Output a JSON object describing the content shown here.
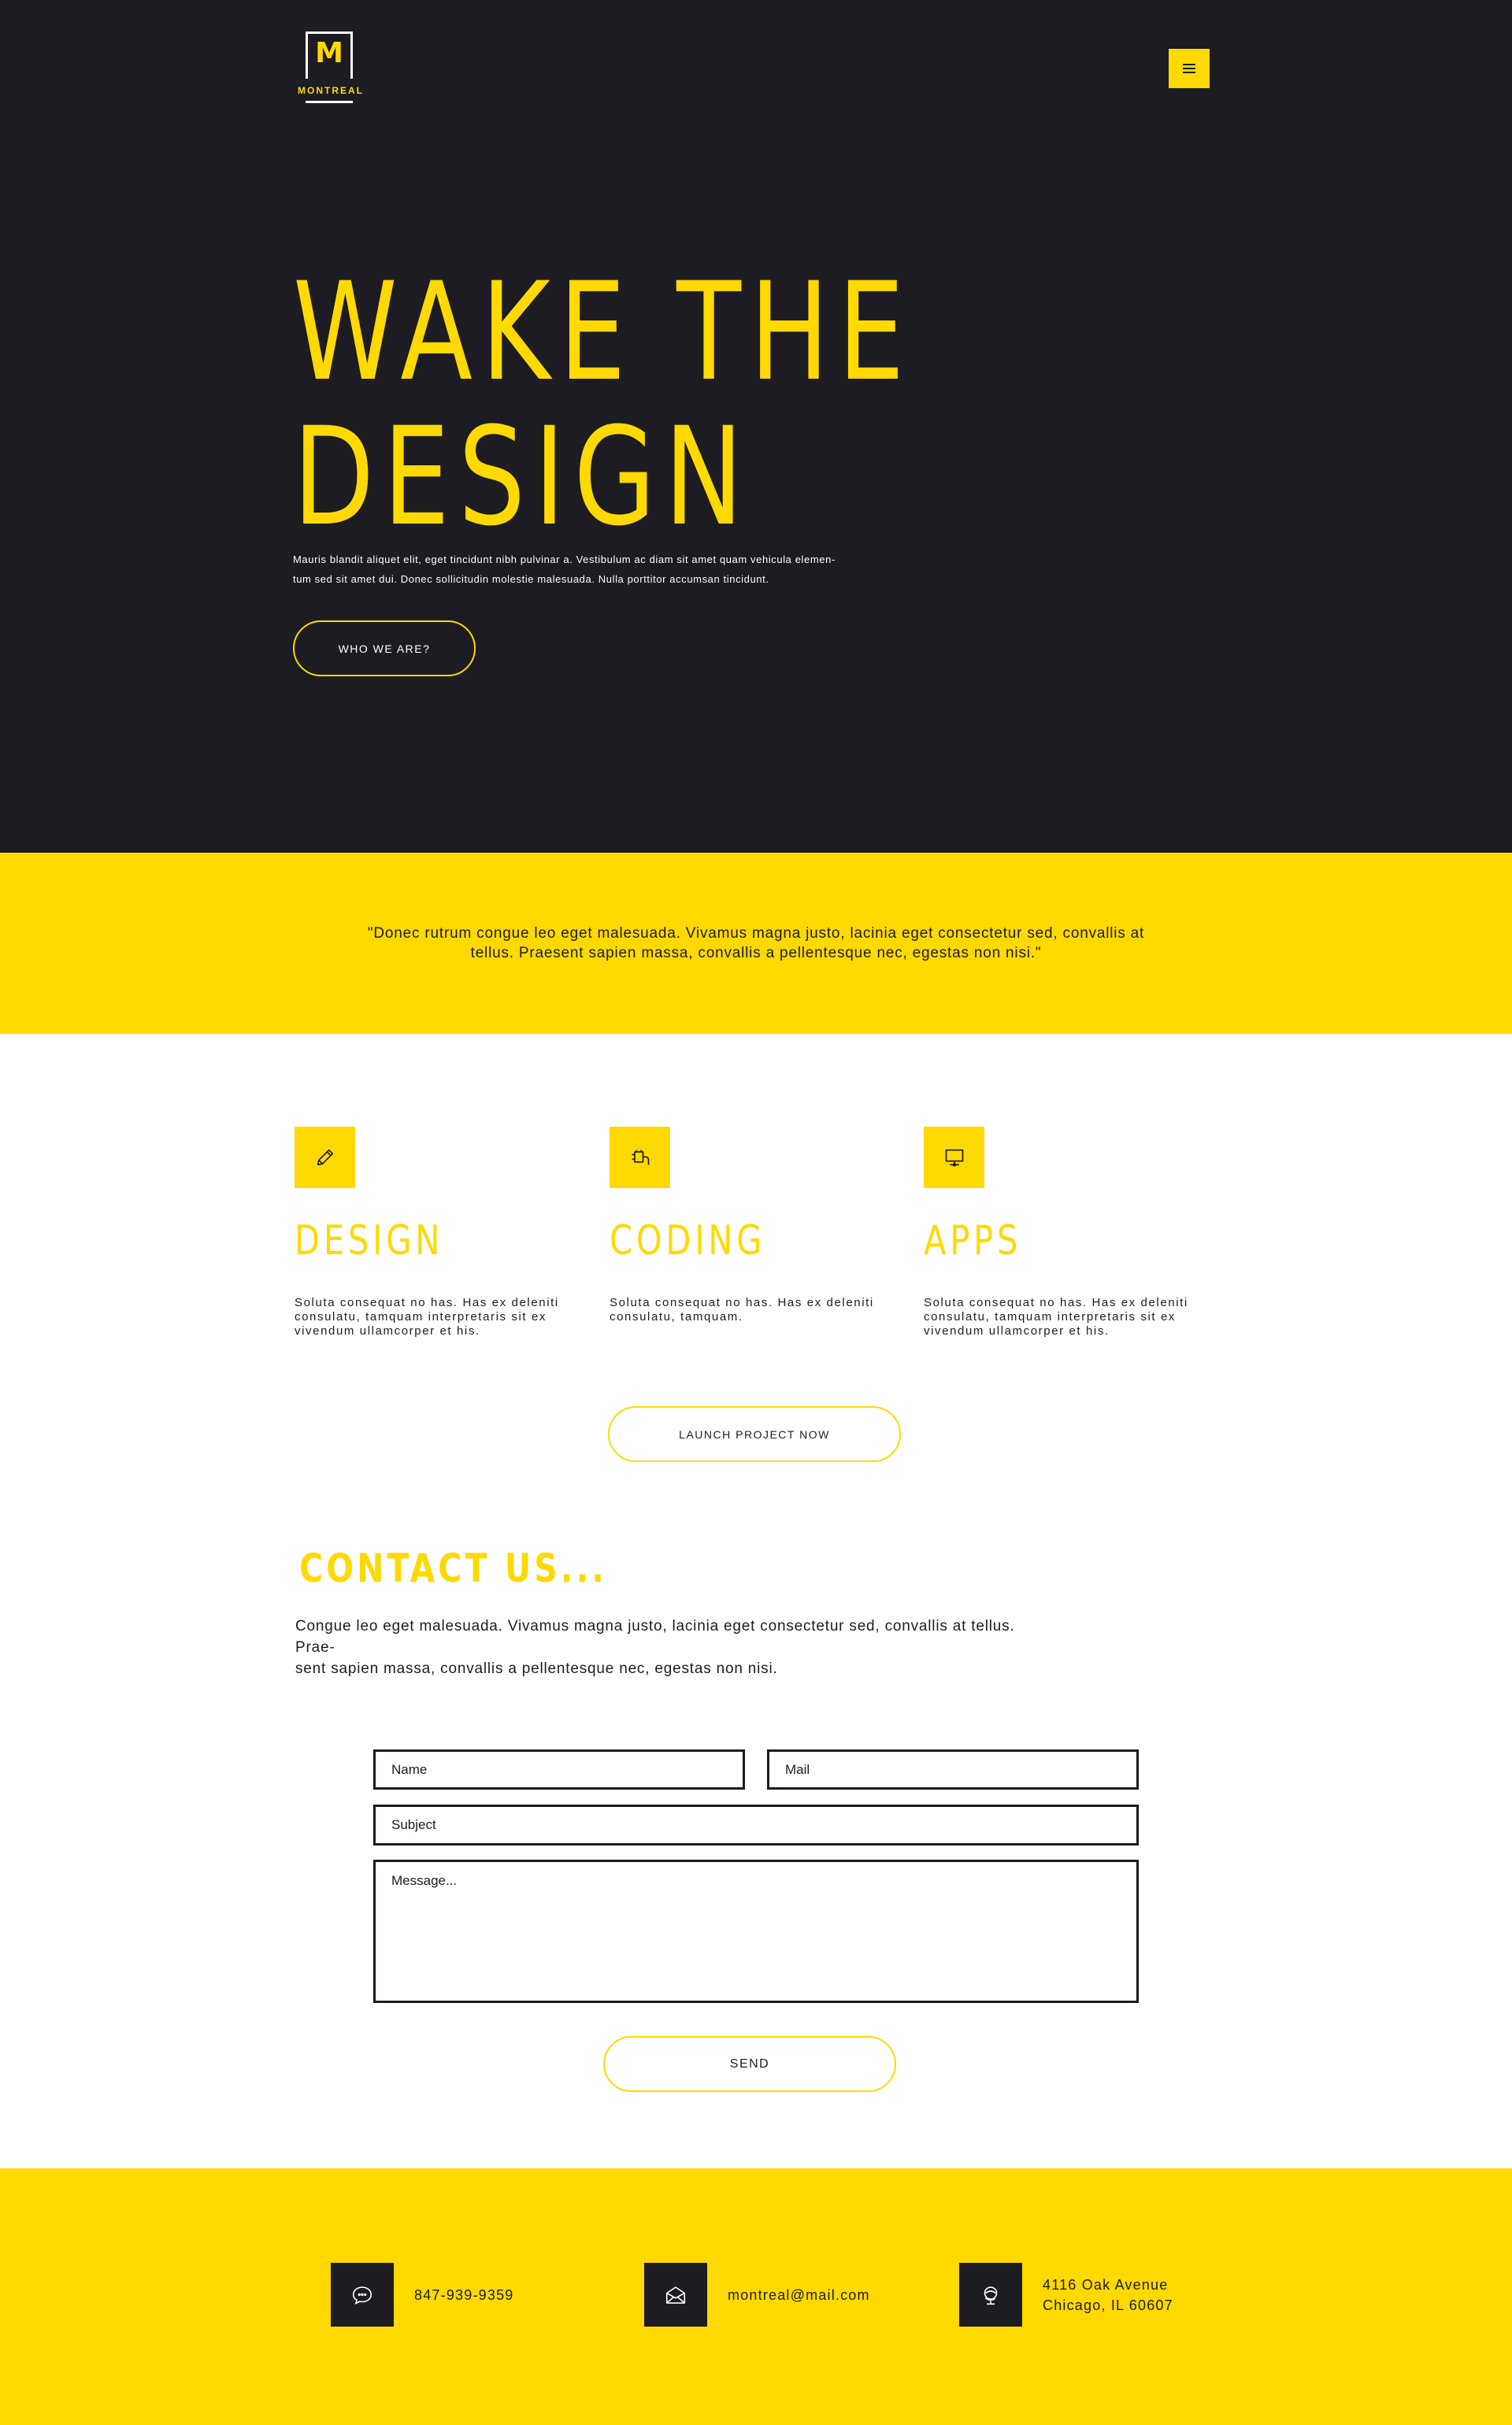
{
  "brand": {
    "logo_letter": "M",
    "logo_text": "MONTREAL"
  },
  "colors": {
    "accent": "#ffd900",
    "dark": "#1c1c22",
    "light": "#ffffff"
  },
  "header": {
    "menu_icon": "hamburger-menu-icon"
  },
  "hero": {
    "title_line1": "WAKE THE",
    "title_line2": "DESIGN",
    "text_line1": "Mauris blandit aliquet elit, eget tincidunt nibh pulvinar a. Vestibulum ac diam sit amet quam vehicula elemen-",
    "text_line2": "tum sed sit amet dui. Donec sollicitudin molestie malesuada. Nulla porttitor accumsan tincidunt.",
    "button_label": "WHO WE ARE?"
  },
  "quote": {
    "line1": "\"Donec rutrum congue leo eget malesuada. Vivamus magna justo, lacinia eget consectetur sed, convallis at",
    "line2": "tellus. Praesent sapien massa, convallis a pellentesque nec, egestas non nisi.\""
  },
  "services": [
    {
      "icon": "pencil-icon",
      "title": "DESIGN",
      "text": "Soluta consequat no has. Has ex deleniti consulatu, tamquam interpretaris sit ex vivendum ullamcorper et his."
    },
    {
      "icon": "plug-icon",
      "title": "CODING",
      "text": "Soluta consequat no has. Has ex deleniti consulatu, tamquam."
    },
    {
      "icon": "monitor-icon",
      "title": "APPS",
      "text": "Soluta consequat no has. Has ex deleniti consulatu, tamquam interpretaris sit ex vivendum ullamcorper et his."
    }
  ],
  "launch_button": "LAUNCH PROJECT NOW",
  "contact": {
    "title": "CONTACT US...",
    "text_line1": "Congue leo eget malesuada. Vivamus magna justo, lacinia eget consectetur sed, convallis at tellus. Prae-",
    "text_line2": "sent sapien massa, convallis a pellentesque nec, egestas non nisi.",
    "name_placeholder": "Name",
    "mail_placeholder": "Mail",
    "subject_placeholder": "Subject",
    "message_placeholder": "Message...",
    "send_label": "SEND"
  },
  "footer": {
    "phone_icon": "chat-bubble-icon",
    "phone": "847-939-9359",
    "mail_icon": "envelope-icon",
    "email": "montreal@mail.com",
    "address_icon": "globe-icon",
    "address_line1": "4116 Oak Avenue",
    "address_line2": "Chicago, IL 60607"
  }
}
